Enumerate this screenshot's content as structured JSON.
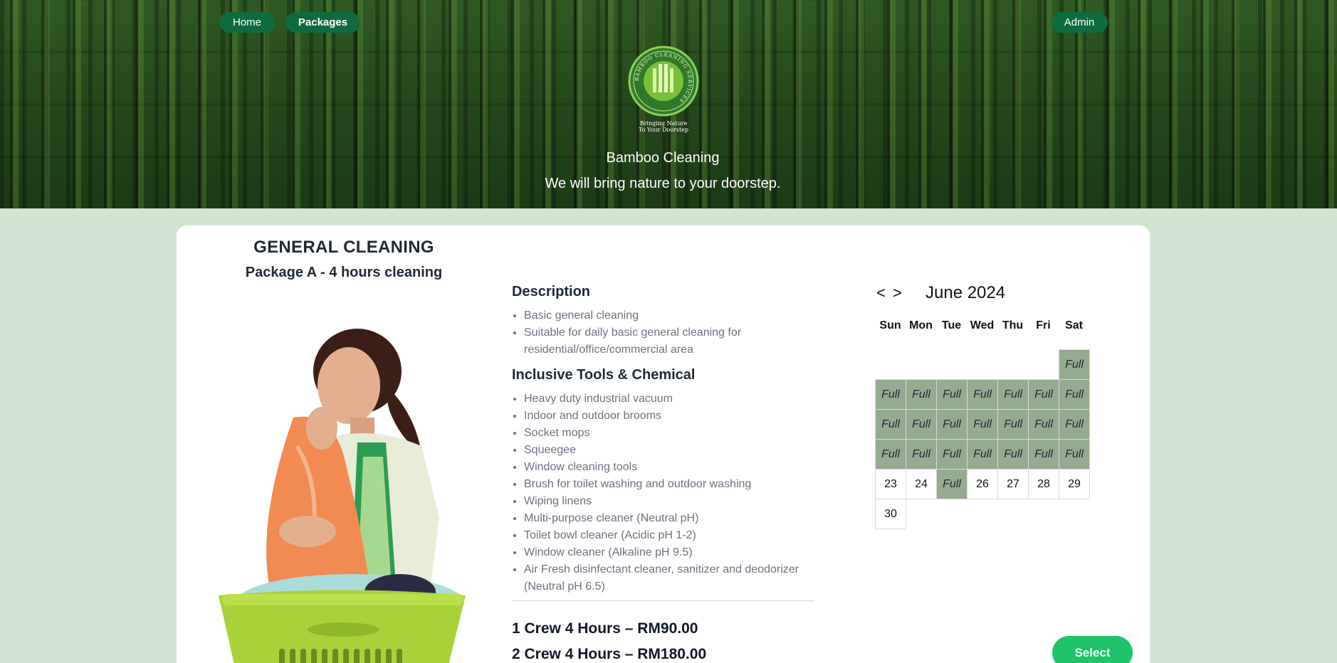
{
  "nav": {
    "home": "Home",
    "packages": "Packages",
    "admin": "Admin"
  },
  "hero": {
    "logo_ring_text": "BAMBOO CLEANING SERVICES",
    "logo_tagline_1": "Bringing Nature",
    "logo_tagline_2": "To Your Doorstep",
    "title": "Bamboo Cleaning",
    "subtitle": "We will bring nature to your doorstep."
  },
  "package": {
    "title": "GENERAL CLEANING",
    "subtitle": "Package A - 4 hours cleaning",
    "description_heading": "Description",
    "description_items": [
      "Basic general cleaning",
      "Suitable for daily basic general cleaning for residential/office/commercial area"
    ],
    "tools_heading": "Inclusive Tools & Chemical",
    "tools_items": [
      "Heavy duty industrial vacuum",
      "Indoor and outdoor brooms",
      "Socket mops",
      "Squeegee",
      "Window cleaning tools",
      "Brush for toilet washing and outdoor washing",
      "Wiping linens",
      "Multi-purpose cleaner (Neutral pH)",
      "Toilet bowl cleaner (Acidic pH 1-2)",
      "Window cleaner (Alkaline pH 9.5)",
      "Air Fresh disinfectant cleaner, sanitizer and deodorizer (Neutral pH 6.5)"
    ],
    "prices": [
      "1 Crew 4 Hours – RM90.00",
      "2 Crew 4 Hours – RM180.00"
    ]
  },
  "calendar": {
    "prev": "<",
    "next": ">",
    "month": "June 2024",
    "weekdays": [
      "Sun",
      "Mon",
      "Tue",
      "Wed",
      "Thu",
      "Fri",
      "Sat"
    ],
    "full_label": "Full",
    "cells": [
      "",
      "",
      "",
      "",
      "",
      "",
      "Full",
      "Full",
      "Full",
      "Full",
      "Full",
      "Full",
      "Full",
      "Full",
      "Full",
      "Full",
      "Full",
      "Full",
      "Full",
      "Full",
      "Full",
      "Full",
      "Full",
      "Full",
      "Full",
      "Full",
      "Full",
      "Full",
      "23",
      "24",
      "Full",
      "26",
      "27",
      "28",
      "29",
      "30"
    ],
    "select_label": "Select"
  },
  "colors": {
    "nav_pill": "#0f6b3e",
    "page_bg": "#d3e4d3",
    "full_cell": "#95ab8f",
    "select_button": "#1ec36a"
  }
}
